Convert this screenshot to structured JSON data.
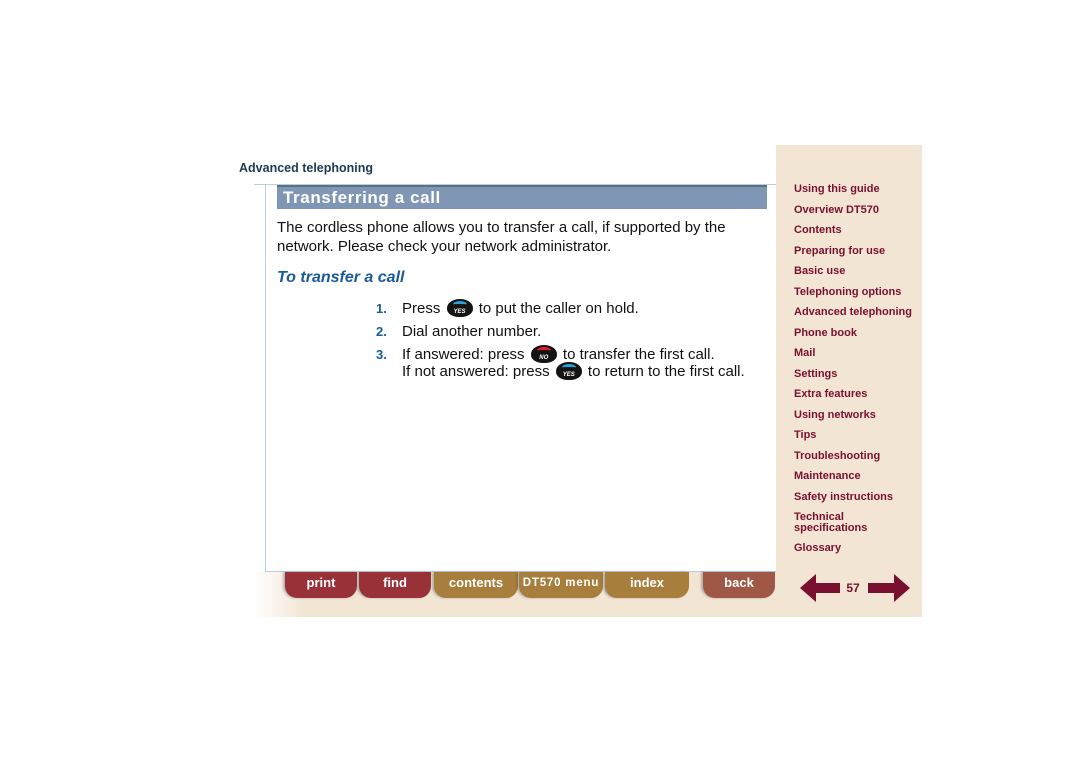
{
  "header": {
    "section": "Advanced telephoning",
    "title": "Transferring a call"
  },
  "content": {
    "intro": "The cordless phone allows you to transfer a call, if supported by the network. Please check your network administrator.",
    "subheading": "To transfer a call",
    "steps": [
      {
        "num": "1.",
        "pre": "Press",
        "key": "YES",
        "post": "to put the caller on hold."
      },
      {
        "num": "2.",
        "text": "Dial another number."
      },
      {
        "num": "3.",
        "pre": "If answered: press",
        "key": "NO",
        "post": "to transfer the first call.",
        "pre2": "If not answered: press",
        "key2": "YES",
        "post2": "to return to the first call."
      }
    ]
  },
  "sidebar": {
    "items": [
      "Using this guide",
      "Overview DT570",
      "Contents",
      "Preparing for use",
      "Basic use",
      "Telephoning options",
      "Advanced telephoning",
      "Phone book",
      "Mail",
      "Settings",
      "Extra features",
      "Using networks",
      "Tips",
      "Troubleshooting",
      "Maintenance",
      "Safety instructions",
      "Technical specifications",
      "Glossary"
    ]
  },
  "footer": {
    "tabs": {
      "print": "print",
      "find": "find",
      "contents": "contents",
      "menu": "DT570 menu",
      "index": "index",
      "back": "back"
    },
    "page_number": "57",
    "icons": {
      "prev": "arrow-left-icon",
      "next": "arrow-right-icon"
    }
  },
  "colors": {
    "title_bar": "#7f97b4",
    "accent_blue": "#1b5a9a",
    "sidebar_bg": "#f3e5d4",
    "sidebar_link": "#7a1030",
    "tab_red": "#983238",
    "tab_gold": "#a77e3c",
    "tab_back": "#9f5845"
  }
}
